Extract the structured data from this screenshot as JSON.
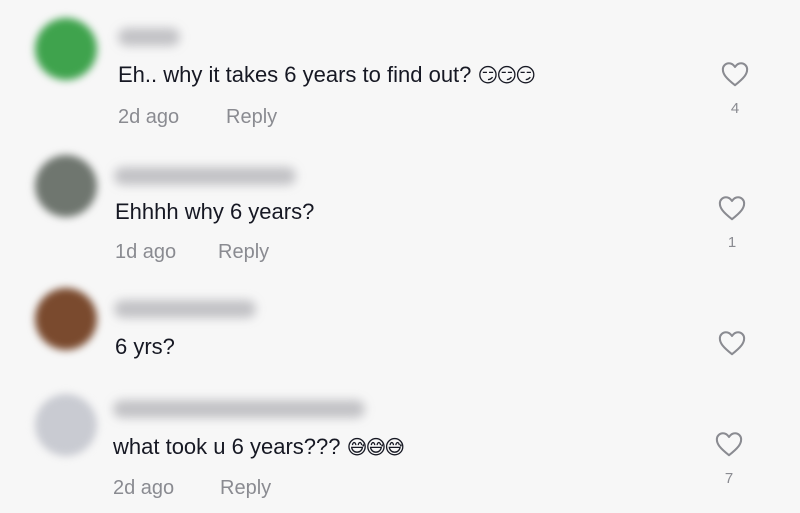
{
  "comments": [
    {
      "text": "Eh.. why it takes 6 years to find out?",
      "emoji": "😏😏😏",
      "time": "2d ago",
      "reply": "Reply",
      "likes": "4",
      "avatar_color": "#3fa34d",
      "icon": "heart-outline-icon"
    },
    {
      "text": "Ehhhh why 6 years?",
      "emoji": "",
      "time": "1d ago",
      "reply": "Reply",
      "likes": "1",
      "avatar_color": "#6f766f",
      "icon": "heart-outline-icon"
    },
    {
      "text": "6 yrs?",
      "emoji": "",
      "time": "",
      "reply": "",
      "likes": "",
      "avatar_color": "#7a4a2e",
      "icon": "heart-outline-icon"
    },
    {
      "text": "what took u 6 years???",
      "emoji": "😅😅😅",
      "time": "2d ago",
      "reply": "Reply",
      "likes": "7",
      "avatar_color": "#c9cbd2",
      "icon": "heart-outline-icon"
    }
  ]
}
